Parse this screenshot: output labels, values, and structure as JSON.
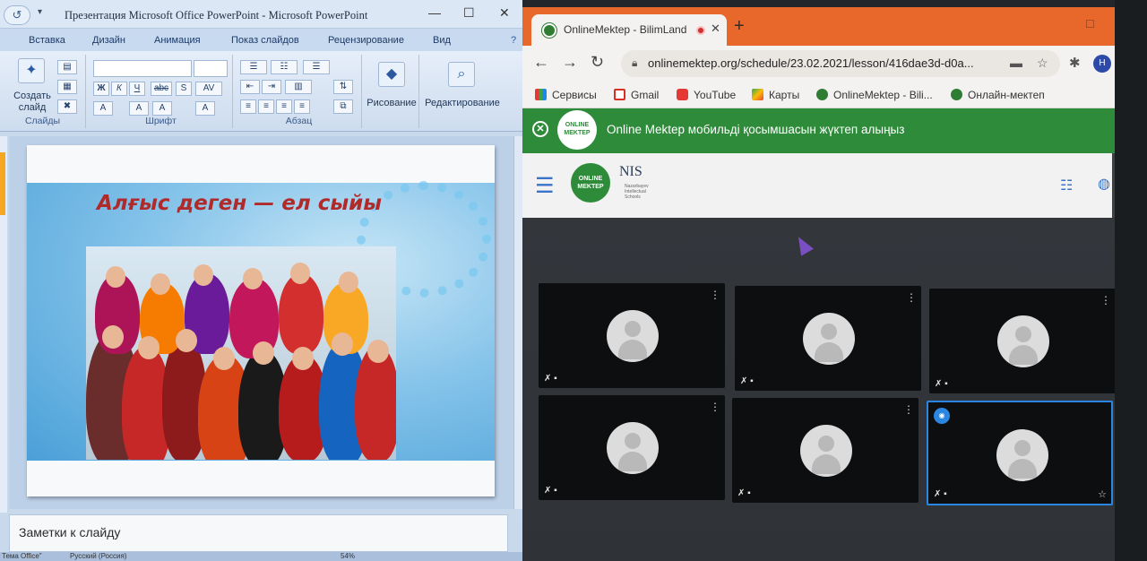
{
  "ppt": {
    "title": "Презентация Microsoft Office PowerPoint - Microsoft PowerPoint",
    "undo_icon": "undo-icon",
    "tabs": [
      "Вставка",
      "Дизайн",
      "Анимация",
      "Показ слайдов",
      "Рецензирование",
      "Вид"
    ],
    "ribbon": {
      "create_slide_label": "Создать слайд",
      "slides_group": "Слайды",
      "font_group": "Шрифт",
      "paragraph_group": "Абзац",
      "drawing_label": "Рисование",
      "editing_label": "Редактирование"
    },
    "slide": {
      "title": "Алғыс деген — ел сыйы"
    },
    "notes_placeholder": "Заметки к слайду",
    "status": {
      "theme": "Тема Office\"",
      "language": "Русский (Россия)",
      "zoom": "54%"
    }
  },
  "chrome": {
    "tab_title": "OnlineMektep - BilimLand",
    "url": "onlinemektep.org/schedule/23.02.2021/lesson/416dae3d-d0a...",
    "profile_initial": "H",
    "bookmarks": [
      "Сервисы",
      "Gmail",
      "YouTube",
      "Карты",
      "OnlineMektep - Bili...",
      "Онлайн-мектеп"
    ],
    "banner_text": "Online Mektep мобильді қосымшасын жүктеп алыңыз",
    "logo_text": "ONLINE MEKTEP",
    "nis_text": "NIS",
    "nis_sub": "Nazarbayev Intellectual Schools",
    "tiles": [
      {
        "active": false
      },
      {
        "active": false
      },
      {
        "active": false
      },
      {
        "active": false
      },
      {
        "active": false
      },
      {
        "active": true
      }
    ],
    "colors": {
      "tabbar": "#e8672a",
      "banner": "#2e8b3a",
      "active_tile_border": "#2a86e0"
    }
  }
}
